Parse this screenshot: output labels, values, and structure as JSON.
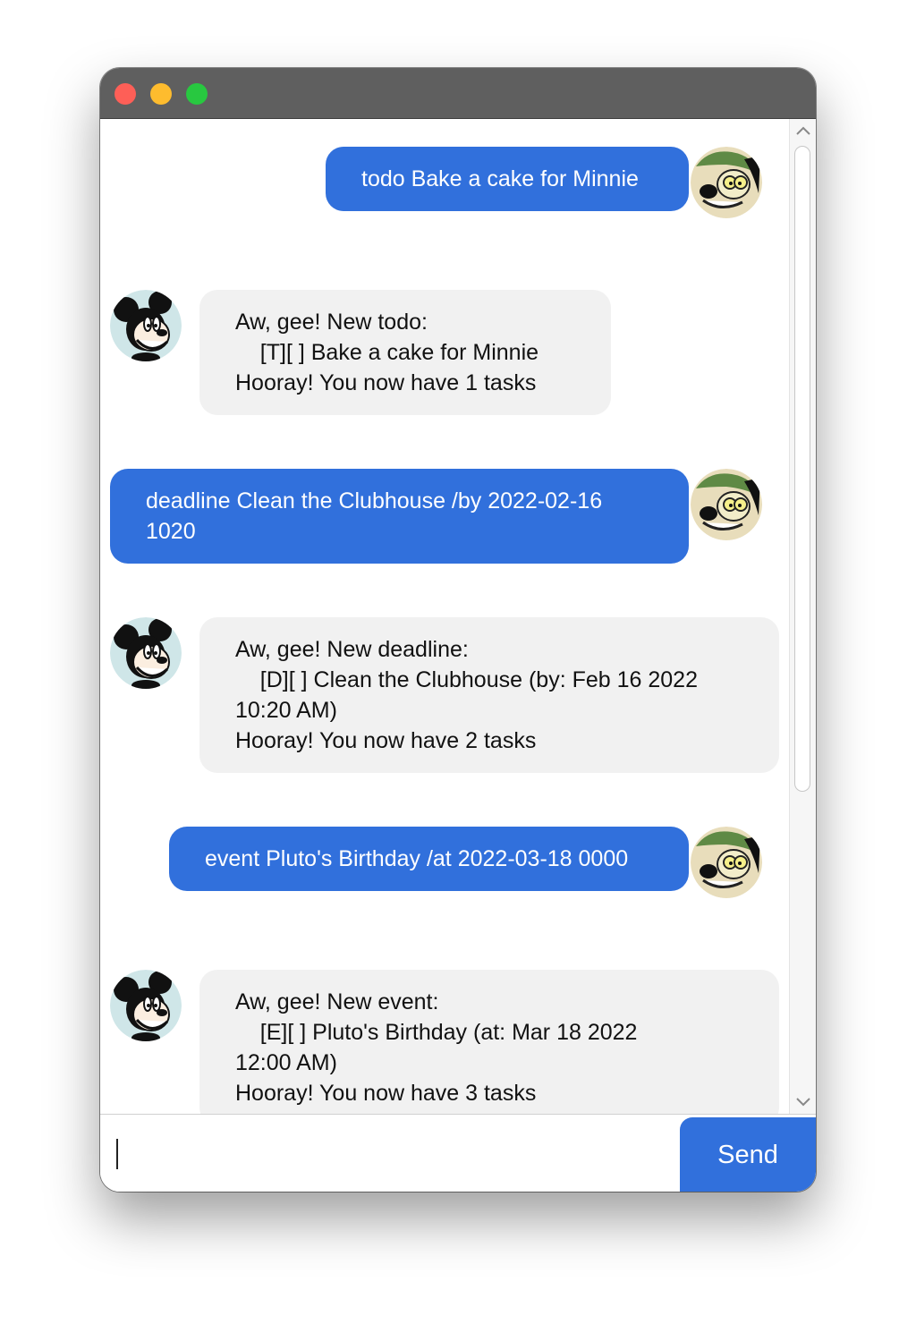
{
  "window": {
    "controls": [
      "close",
      "minimize",
      "maximize"
    ]
  },
  "messages": [
    {
      "sender": "user",
      "avatar": "goofy-avatar",
      "text": "todo Bake a cake for Minnie"
    },
    {
      "sender": "bot",
      "avatar": "mickey-avatar",
      "text": "Aw, gee! New todo:\n\t[T][ ] Bake a cake for Minnie\nHooray! You now have 1 tasks"
    },
    {
      "sender": "user",
      "avatar": "goofy-avatar",
      "text": "deadline Clean the Clubhouse /by 2022-02-16\n1020"
    },
    {
      "sender": "bot",
      "avatar": "mickey-avatar",
      "text": "Aw, gee! New deadline:\n\t[D][ ] Clean the Clubhouse (by: Feb 16 2022\n10:20 AM)\nHooray! You now have 2 tasks"
    },
    {
      "sender": "user",
      "avatar": "goofy-avatar",
      "text": "event Pluto's Birthday /at 2022-03-18 0000"
    },
    {
      "sender": "bot",
      "avatar": "mickey-avatar",
      "text": "Aw, gee! New event:\n\t[E][ ] Pluto's Birthday (at: Mar 18 2022\n12:00 AM)\nHooray! You now have 3 tasks"
    }
  ],
  "input": {
    "value": "",
    "placeholder": ""
  },
  "send_button": {
    "label": "Send"
  },
  "colors": {
    "user_bubble": "#3170dc",
    "bot_bubble": "#f1f1f1",
    "titlebar": "#5f5f5f",
    "send_button": "#3170dc"
  }
}
